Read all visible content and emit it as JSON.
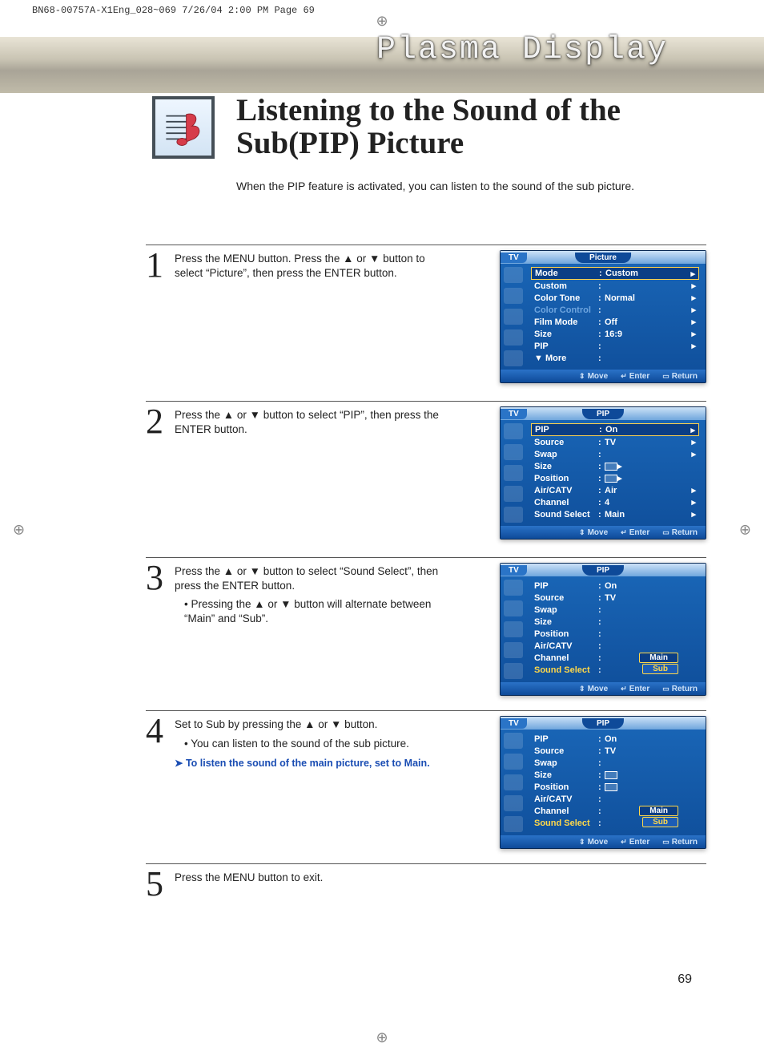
{
  "print_header": "BN68-00757A-X1Eng_028~069  7/26/04  2:00 PM  Page 69",
  "brand": "Plasma Display",
  "title": "Listening to the Sound of the Sub(PIP) Picture",
  "intro": "When the PIP feature is activated, you can listen to the sound of the sub picture.",
  "page_number": "69",
  "steps": [
    {
      "num": "1",
      "text": "Press the MENU button. Press the ▲ or ▼ button to select “Picture”, then press the ENTER button."
    },
    {
      "num": "2",
      "text": "Press the ▲ or ▼ button to select “PIP”, then press the ENTER button."
    },
    {
      "num": "3",
      "text": "Press the ▲ or ▼ button to select “Sound Select”, then press the ENTER button.",
      "bullet": "Pressing the ▲ or ▼ button will alternate between “Main” and “Sub”."
    },
    {
      "num": "4",
      "text": "Set to Sub by pressing the ▲ or ▼ button.",
      "bullet": "You can listen to the sound of the sub picture.",
      "note": "To listen the sound of the main picture, set to Main."
    },
    {
      "num": "5",
      "text": "Press the MENU button to exit."
    }
  ],
  "osd_footer": {
    "move": "Move",
    "enter": "Enter",
    "return": "Return"
  },
  "osd1": {
    "tv": "TV",
    "title": "Picture",
    "rows": [
      {
        "label": "Mode",
        "val": "Custom",
        "sel": true,
        "arr": true
      },
      {
        "label": "Custom",
        "val": "",
        "arr": true
      },
      {
        "label": "Color Tone",
        "val": "Normal",
        "arr": true
      },
      {
        "label": "Color Control",
        "val": "",
        "arr": true,
        "dim": true
      },
      {
        "label": "Film Mode",
        "val": "Off",
        "arr": true
      },
      {
        "label": "Size",
        "val": "16:9",
        "arr": true
      },
      {
        "label": "PIP",
        "val": "",
        "arr": true
      },
      {
        "label": "▼ More",
        "val": ""
      }
    ]
  },
  "osd2": {
    "tv": "TV",
    "title": "PIP",
    "rows": [
      {
        "label": "PIP",
        "val": "On",
        "sel": true,
        "arr": true
      },
      {
        "label": "Source",
        "val": "TV",
        "arr": true
      },
      {
        "label": "Swap",
        "val": "",
        "arr": true
      },
      {
        "label": "Size",
        "val": "[pic]",
        "arr": true
      },
      {
        "label": "Position",
        "val": "[pic]",
        "arr": true
      },
      {
        "label": "Air/CATV",
        "val": "Air",
        "arr": true
      },
      {
        "label": "Channel",
        "val": "4",
        "arr": true
      },
      {
        "label": "Sound Select",
        "val": "Main",
        "arr": true
      }
    ]
  },
  "osd3": {
    "tv": "TV",
    "title": "PIP",
    "rows": [
      {
        "label": "PIP",
        "val": "On"
      },
      {
        "label": "Source",
        "val": "TV"
      },
      {
        "label": "Swap",
        "val": ""
      },
      {
        "label": "Size",
        "val": ""
      },
      {
        "label": "Position",
        "val": ""
      },
      {
        "label": "Air/CATV",
        "val": ""
      },
      {
        "label": "Channel",
        "val": ""
      },
      {
        "label": "Sound Select",
        "val": "",
        "hl": true,
        "options": [
          "Main",
          "Sub"
        ]
      }
    ]
  },
  "osd4": {
    "tv": "TV",
    "title": "PIP",
    "rows": [
      {
        "label": "PIP",
        "val": "On"
      },
      {
        "label": "Source",
        "val": "TV"
      },
      {
        "label": "Swap",
        "val": ""
      },
      {
        "label": "Size",
        "val": "[pic]"
      },
      {
        "label": "Position",
        "val": "[pic]"
      },
      {
        "label": "Air/CATV",
        "val": ""
      },
      {
        "label": "Channel",
        "val": ""
      },
      {
        "label": "Sound Select",
        "val": "",
        "hl": true,
        "options": [
          "Main",
          "Sub"
        ],
        "subsel": true
      }
    ]
  }
}
